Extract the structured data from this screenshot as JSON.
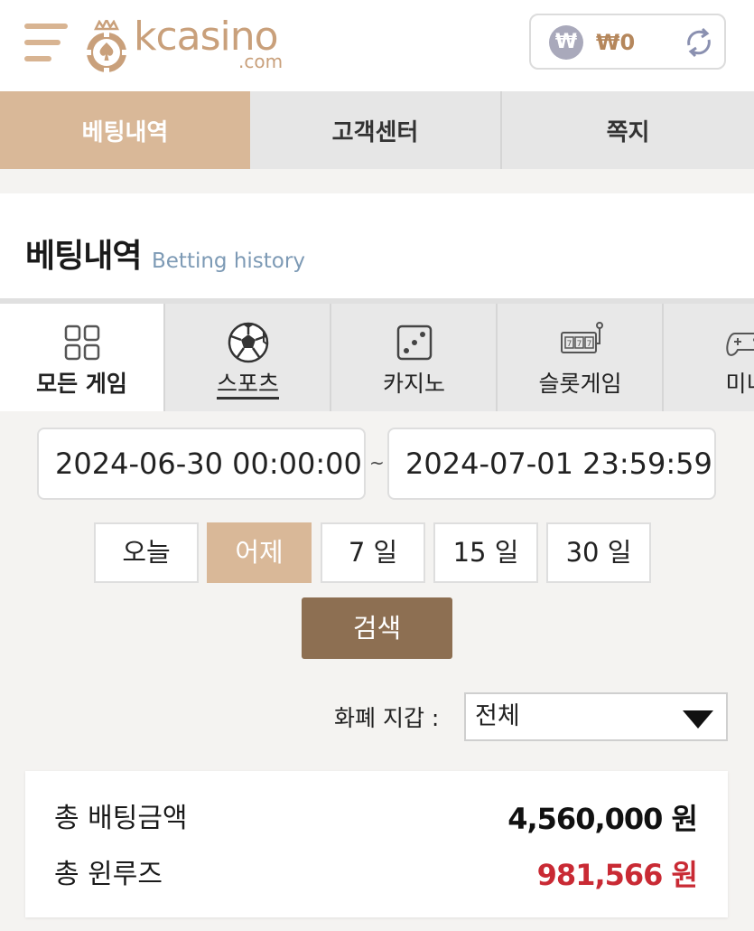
{
  "header": {
    "logo_text": "kcasino",
    "logo_domain": ".com",
    "wallet_currency_symbol": "₩",
    "wallet_amount": "₩0"
  },
  "top_tabs": [
    {
      "label": "베팅내역",
      "active": true
    },
    {
      "label": "고객센터",
      "active": false
    },
    {
      "label": "쪽지",
      "active": false
    }
  ],
  "section": {
    "title": "베팅내역",
    "subtitle": "Betting history"
  },
  "game_tabs": [
    {
      "label": "모든 게임",
      "icon": "grid-icon",
      "active": true
    },
    {
      "label": "스포츠",
      "icon": "soccer-ball-icon",
      "active": false
    },
    {
      "label": "카지노",
      "icon": "dice-icon",
      "active": false
    },
    {
      "label": "슬롯게임",
      "icon": "slot-machine-icon",
      "active": false
    },
    {
      "label": "미니",
      "icon": "gamepad-icon",
      "active": false
    }
  ],
  "date_range": {
    "from": "2024-06-30 00:00:00",
    "separator": "~",
    "to": "2024-07-01 23:59:59"
  },
  "quick_buttons": [
    {
      "label": "오늘",
      "active": false
    },
    {
      "label": "어제",
      "active": true
    },
    {
      "label": "7 일",
      "active": false
    },
    {
      "label": "15 일",
      "active": false
    },
    {
      "label": "30 일",
      "active": false
    }
  ],
  "search_label": "검색",
  "wallet_filter": {
    "label": "화폐 지갑 :",
    "selected": "전체"
  },
  "summary": {
    "total_bet_label": "총 배팅금액",
    "total_bet_value": "4,560,000 원",
    "total_winloss_label": "총 윈루즈",
    "total_winloss_value": "981,566 원"
  },
  "colors": {
    "accent": "#d9b898",
    "brand_text": "#c9a07b",
    "search_button": "#8d6f52",
    "loss_red": "#c92a34",
    "subtitle_blue": "#7d9ab5"
  }
}
